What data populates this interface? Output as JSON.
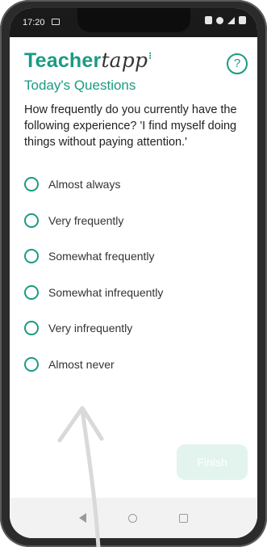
{
  "status_bar": {
    "time": "17:20"
  },
  "brand": {
    "part1": "Teacher",
    "part2": "tapp",
    "spark": "⁝"
  },
  "help": {
    "label": "?"
  },
  "section_title": "Today's Questions",
  "question": "How frequently do you currently have the following experience? 'I find myself doing things without paying attention.'",
  "options": [
    "Almost always",
    "Very frequently",
    "Somewhat frequently",
    "Somewhat infrequently",
    "Very infrequently",
    "Almost never"
  ],
  "finish_button": {
    "label": "Finish"
  },
  "colors": {
    "accent": "#1a9b82",
    "finish_bg": "#e3f4ef"
  }
}
